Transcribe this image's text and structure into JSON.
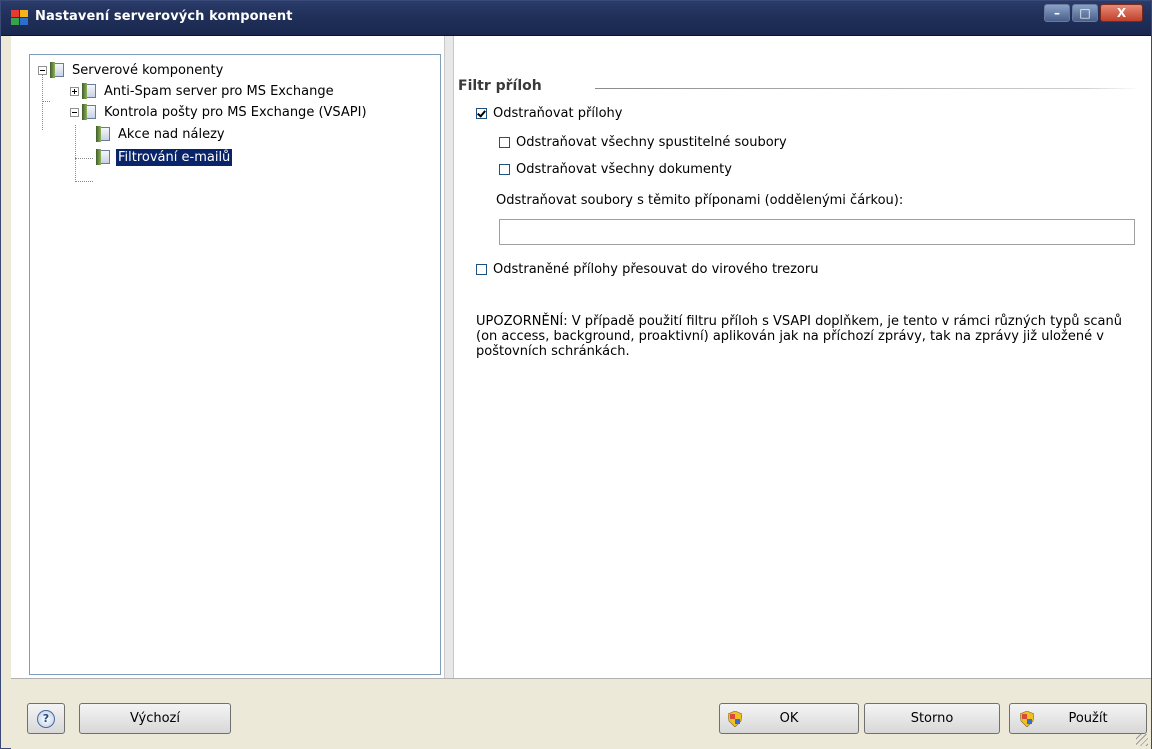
{
  "window": {
    "title": "Nastavení serverových komponent",
    "controls": {
      "minimize": "–",
      "maximize": "□",
      "close": "X"
    }
  },
  "tree": {
    "root": "Serverové komponenty",
    "items": [
      {
        "label": "Anti-Spam server pro MS Exchange",
        "expander": "plus"
      },
      {
        "label": "Kontrola pošty pro MS Exchange (VSAPI)",
        "expander": "minus"
      },
      {
        "label": "Akce nad nálezy"
      },
      {
        "label": "Filtrování e-mailů",
        "selected": true
      }
    ]
  },
  "panel": {
    "section_title": "Filtr příloh",
    "remove_attachments": {
      "label": "Odstraňovat přílohy",
      "checked": true
    },
    "remove_executables": {
      "label": "Odstraňovat všechny spustitelné soubory",
      "checked": false
    },
    "remove_documents": {
      "label": "Odstraňovat všechny dokumenty",
      "checked": false
    },
    "extensions_label": "Odstraňovat soubory s těmito příponami (oddělenými čárkou):",
    "extensions_value": "",
    "move_to_vault": {
      "label": "Odstraněné přílohy přesouvat do virového trezoru",
      "checked": false
    },
    "note": "UPOZORNĚNÍ: V případě použití filtru příloh s VSAPI doplňkem, je tento v rámci různých typů scanů (on access, background, proaktivní) aplikován jak na příchozí zprávy, tak na zprávy již uložené v poštovních schránkách."
  },
  "buttons": {
    "help": "?",
    "default": "Výchozí",
    "ok": "OK",
    "cancel": "Storno",
    "apply": "Použít"
  },
  "colors": {
    "titlebar": "#203058",
    "selection": "#0a246a",
    "tree_border": "#7f9db9"
  }
}
